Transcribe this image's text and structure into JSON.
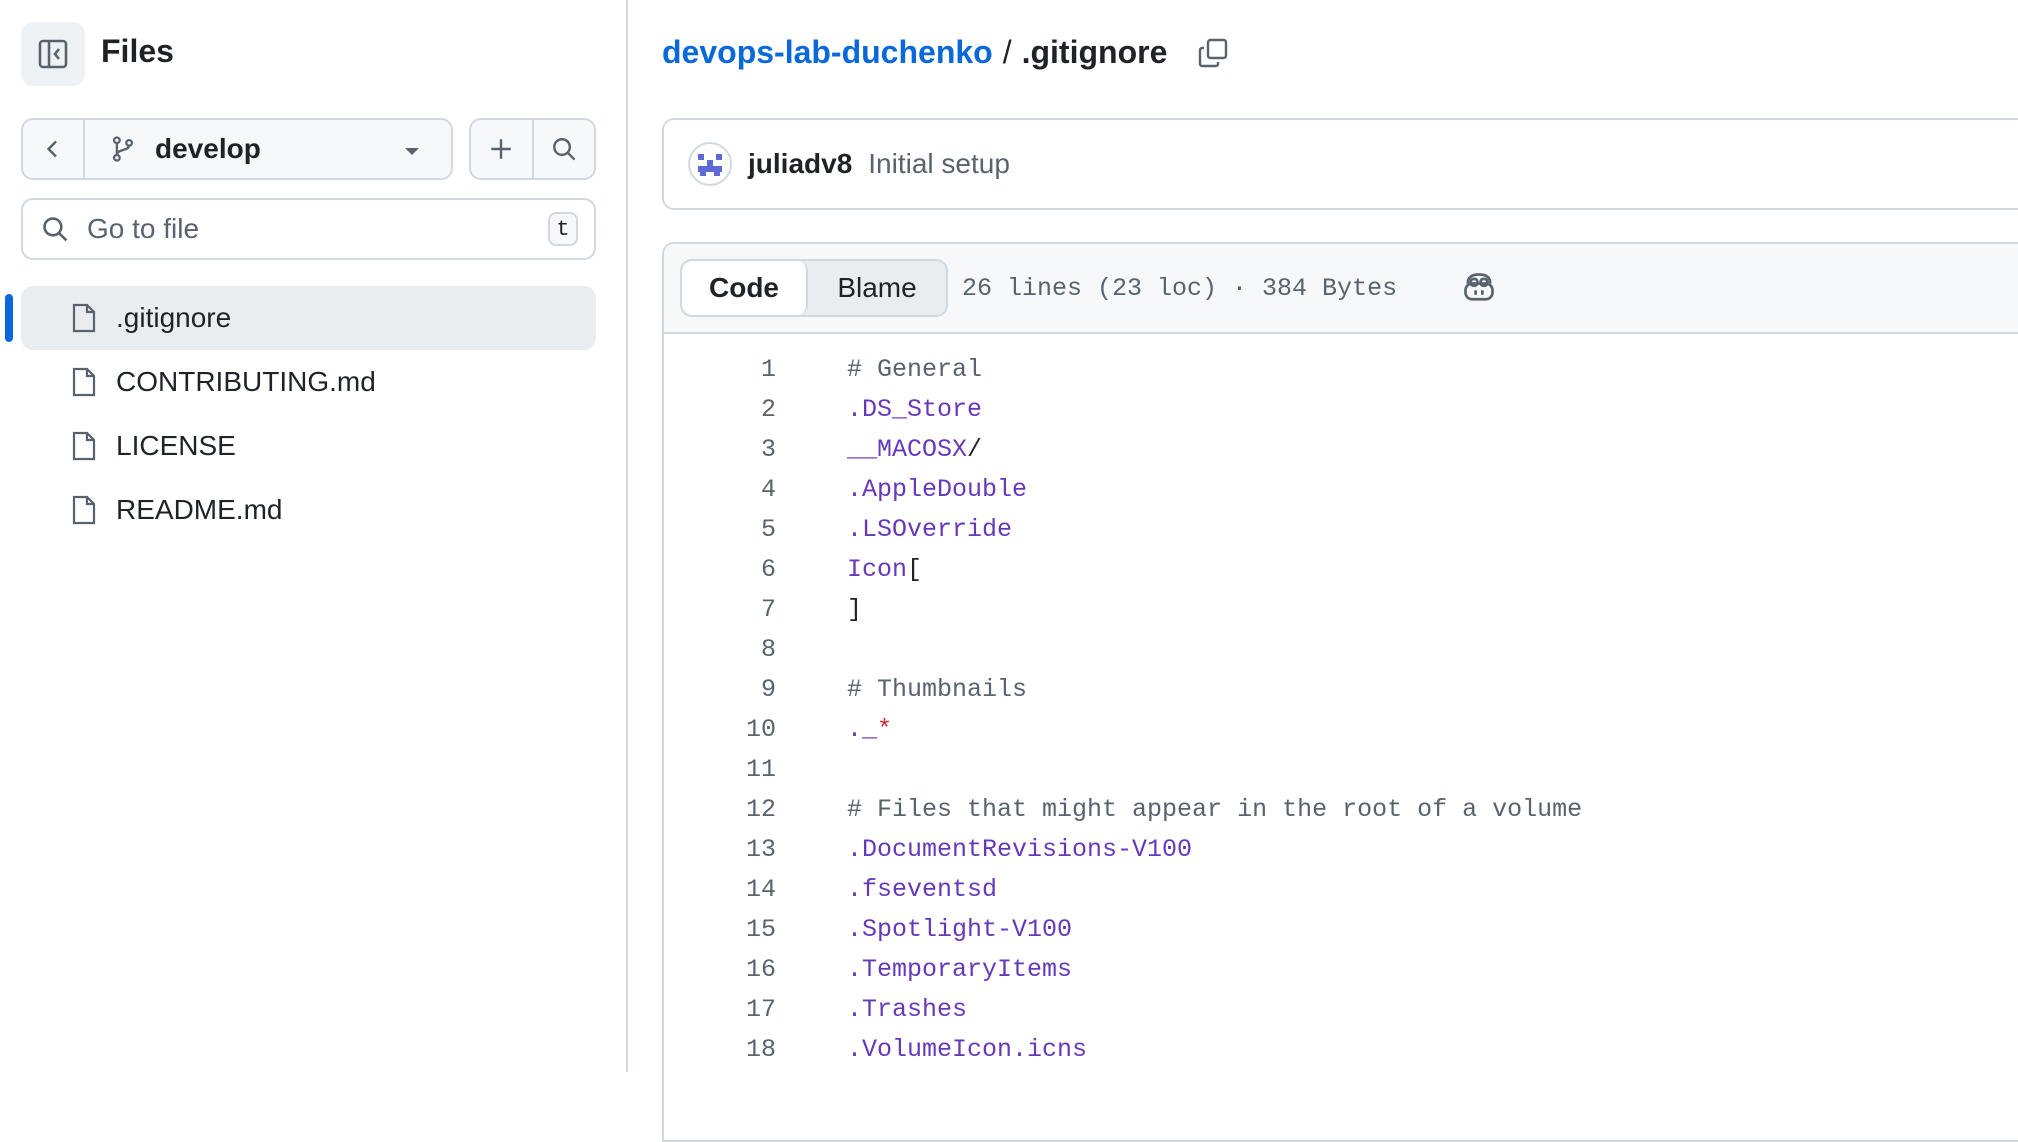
{
  "sidebar": {
    "title": "Files",
    "branch": "develop",
    "go_to_file_placeholder": "Go to file",
    "go_to_file_key": "t",
    "files": [
      {
        "name": ".gitignore",
        "selected": true
      },
      {
        "name": "CONTRIBUTING.md",
        "selected": false
      },
      {
        "name": "LICENSE",
        "selected": false
      },
      {
        "name": "README.md",
        "selected": false
      }
    ]
  },
  "breadcrumb": {
    "repo": "devops-lab-duchenko",
    "separator": "/",
    "file": ".gitignore"
  },
  "commit": {
    "author": "juliadv8",
    "message": "Initial setup"
  },
  "code_view": {
    "tabs": [
      "Code",
      "Blame"
    ],
    "active_tab": "Code",
    "file_info": "26 lines (23 loc) · 384 Bytes",
    "lines": [
      {
        "n": "1",
        "tokens": [
          {
            "t": "# General",
            "c": "comment"
          }
        ]
      },
      {
        "n": "2",
        "tokens": [
          {
            "t": ".DS_Store",
            "c": "entity"
          }
        ]
      },
      {
        "n": "3",
        "tokens": [
          {
            "t": "__MACOSX",
            "c": "entity"
          },
          {
            "t": "/",
            "c": "plain"
          }
        ]
      },
      {
        "n": "4",
        "tokens": [
          {
            "t": ".AppleDouble",
            "c": "entity"
          }
        ]
      },
      {
        "n": "5",
        "tokens": [
          {
            "t": ".LSOverride",
            "c": "entity"
          }
        ]
      },
      {
        "n": "6",
        "tokens": [
          {
            "t": "Icon",
            "c": "entity"
          },
          {
            "t": "[",
            "c": "plain"
          }
        ]
      },
      {
        "n": "7",
        "tokens": [
          {
            "t": "]",
            "c": "plain"
          }
        ]
      },
      {
        "n": "8",
        "tokens": []
      },
      {
        "n": "9",
        "tokens": [
          {
            "t": "# Thumbnails",
            "c": "comment"
          }
        ]
      },
      {
        "n": "10",
        "tokens": [
          {
            "t": "._",
            "c": "entity"
          },
          {
            "t": "*",
            "c": "keyword"
          }
        ]
      },
      {
        "n": "11",
        "tokens": []
      },
      {
        "n": "12",
        "tokens": [
          {
            "t": "# Files that might appear in the root of a volume",
            "c": "comment"
          }
        ]
      },
      {
        "n": "13",
        "tokens": [
          {
            "t": ".DocumentRevisions-V100",
            "c": "entity"
          }
        ]
      },
      {
        "n": "14",
        "tokens": [
          {
            "t": ".fseventsd",
            "c": "entity"
          }
        ]
      },
      {
        "n": "15",
        "tokens": [
          {
            "t": ".Spotlight-V100",
            "c": "entity"
          }
        ]
      },
      {
        "n": "16",
        "tokens": [
          {
            "t": ".TemporaryItems",
            "c": "entity"
          }
        ]
      },
      {
        "n": "17",
        "tokens": [
          {
            "t": ".Trashes",
            "c": "entity"
          }
        ]
      },
      {
        "n": "18",
        "tokens": [
          {
            "t": ".VolumeIcon.icns",
            "c": "entity"
          }
        ]
      }
    ]
  },
  "colors": {
    "link": "#0969da",
    "comment": "#59636e",
    "entity": "#6639ba",
    "keyword": "#cf222e",
    "border": "#d1d9e0"
  },
  "icons": [
    "sidebar-collapse-icon",
    "chevron-left-icon",
    "git-branch-icon",
    "caret-down-icon",
    "plus-icon",
    "search-icon",
    "file-icon",
    "copy-icon",
    "copilot-icon",
    "avatar"
  ]
}
